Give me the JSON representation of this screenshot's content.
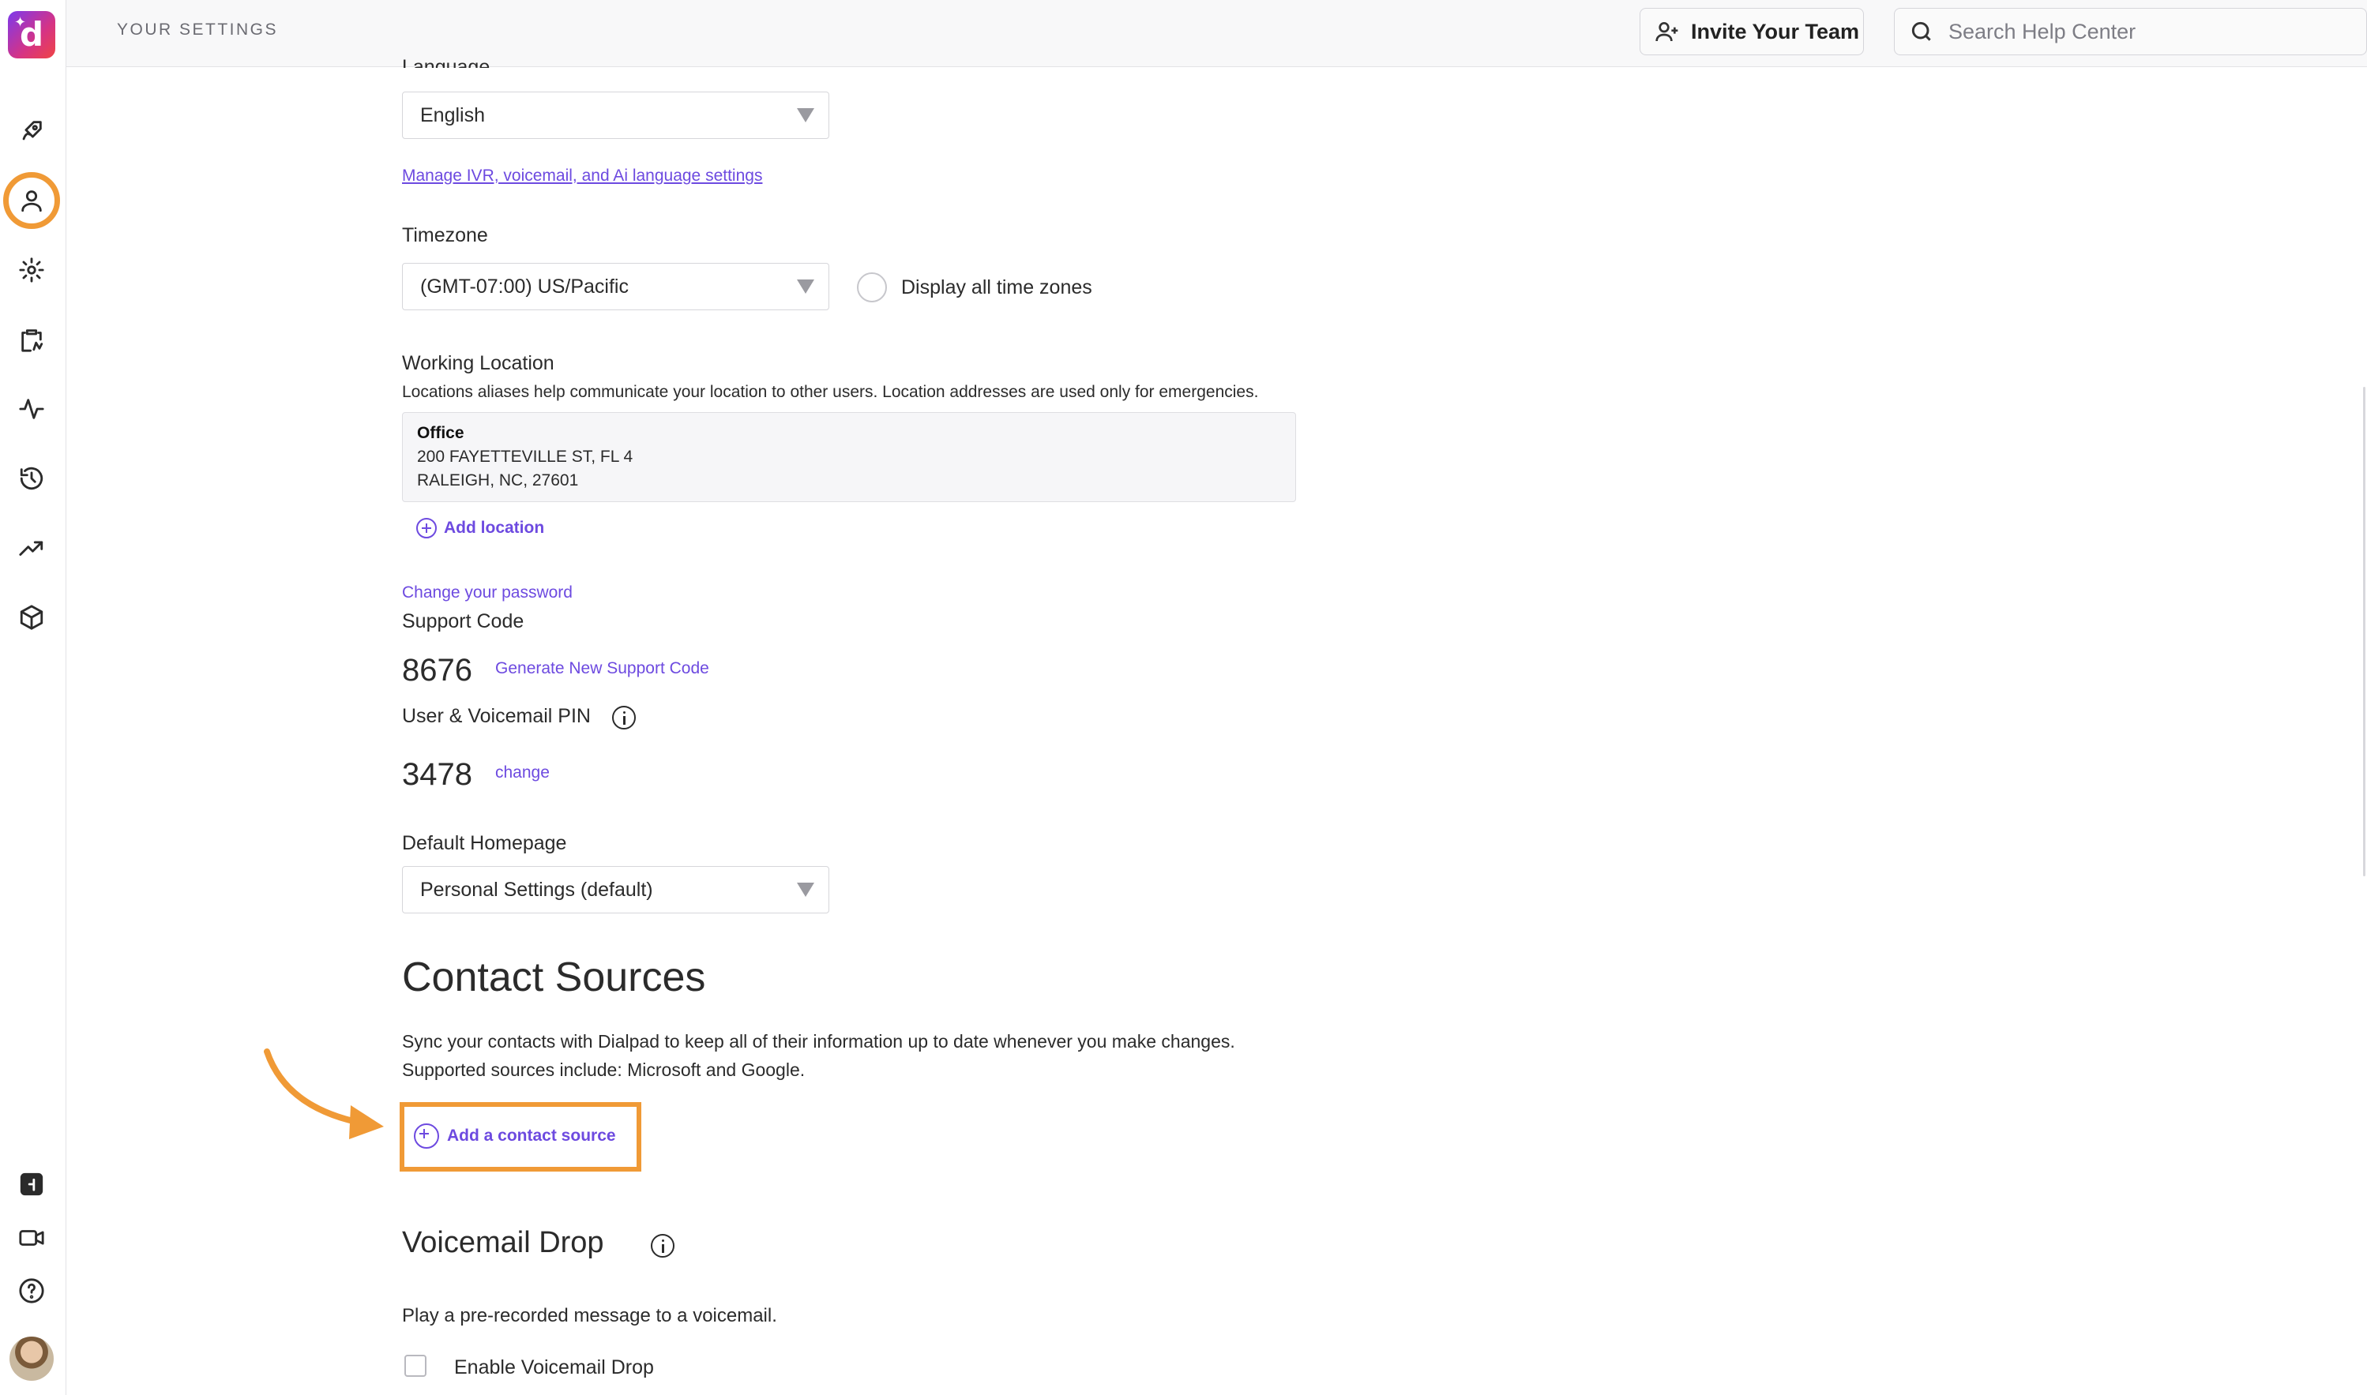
{
  "header": {
    "title": "YOUR SETTINGS",
    "invite_label": "Invite Your Team",
    "search_placeholder": "Search Help Center"
  },
  "rail": {
    "icons": [
      "rocket-icon",
      "user-icon",
      "gear-icon",
      "clipboard-icon",
      "activity-icon",
      "history-icon",
      "trending-icon",
      "box-icon",
      "ai-icon",
      "video-icon",
      "help-icon"
    ],
    "active": "user-icon"
  },
  "language": {
    "label": "Language",
    "value": "English",
    "link": "Manage IVR, voicemail, and Ai language settings"
  },
  "timezone": {
    "label": "Timezone",
    "value": "(GMT-07:00) US/Pacific",
    "display_all_label": "Display all time zones"
  },
  "working_location": {
    "label": "Working Location",
    "description": "Locations aliases help communicate your location to other users. Location addresses are used only for emergencies.",
    "name": "Office",
    "address_line1": "200 FAYETTEVILLE ST, FL 4",
    "address_line2": "RALEIGH, NC, 27601",
    "add_label": "Add location"
  },
  "password": {
    "change_link": "Change your password"
  },
  "support_code": {
    "label": "Support Code",
    "value": "8676",
    "generate_link": "Generate New Support Code"
  },
  "pin": {
    "label": "User & Voicemail PIN",
    "value": "3478",
    "change_link": "change"
  },
  "homepage": {
    "label": "Default Homepage",
    "value": "Personal Settings (default)"
  },
  "contact_sources": {
    "heading": "Contact Sources",
    "description_line1": "Sync your contacts with Dialpad to keep all of their information up to date whenever you make changes.",
    "description_line2": "Supported sources include: Microsoft and Google.",
    "add_label": "Add a contact source"
  },
  "voicemail_drop": {
    "heading": "Voicemail Drop",
    "description": "Play a pre-recorded message to a voicemail.",
    "enable_label": "Enable Voicemail Drop"
  },
  "colors": {
    "accent": "#6d4ae0",
    "highlight": "#f09a36"
  }
}
